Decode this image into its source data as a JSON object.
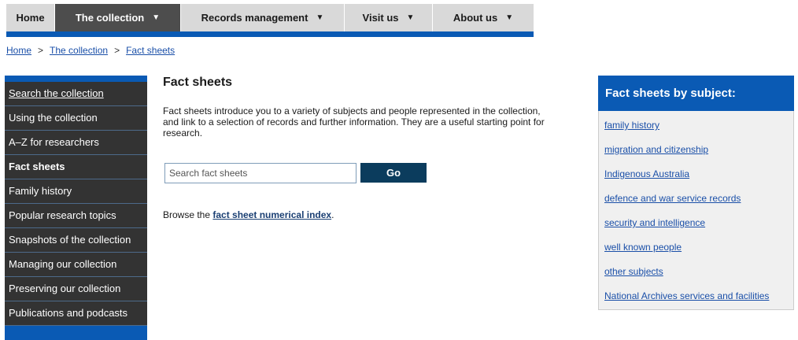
{
  "topnav": {
    "tabs": [
      {
        "label": "Home",
        "dropdown": false,
        "active": false
      },
      {
        "label": "The collection",
        "dropdown": true,
        "active": true
      },
      {
        "label": "Records management",
        "dropdown": true,
        "active": false
      },
      {
        "label": "Visit us",
        "dropdown": true,
        "active": false
      },
      {
        "label": "About us",
        "dropdown": true,
        "active": false
      }
    ],
    "caret": "▼"
  },
  "breadcrumb": {
    "items": [
      "Home",
      "The collection",
      "Fact sheets"
    ],
    "separator": ">"
  },
  "sidebar": {
    "items": [
      {
        "label": "Search the collection"
      },
      {
        "label": "Using the collection"
      },
      {
        "label": "A–Z for researchers"
      },
      {
        "label": "Fact sheets"
      },
      {
        "label": "Family history"
      },
      {
        "label": "Popular research topics"
      },
      {
        "label": "Snapshots of the collection"
      },
      {
        "label": "Managing our collection"
      },
      {
        "label": "Preserving our collection"
      },
      {
        "label": "Publications and podcasts"
      }
    ]
  },
  "main": {
    "title": "Fact sheets",
    "intro": "Fact sheets introduce you to a variety of subjects and people represented in the collection, and link to a selection of records and further information. They are a useful starting point for research.",
    "search": {
      "placeholder": "Search fact sheets",
      "value": "",
      "button_label": "Go"
    },
    "browse": {
      "prefix": "Browse the ",
      "link": "fact sheet numerical index",
      "suffix": "."
    }
  },
  "subject_panel": {
    "title": "Fact sheets by subject:",
    "links": [
      "family history",
      "migration and citizenship",
      "Indigenous Australia",
      "defence and war service records",
      "security and intelligence",
      "well known people",
      "other subjects",
      "National Archives services and facilities"
    ]
  },
  "colors": {
    "accent_blue": "#0a5ab4",
    "dark_nav": "#333333",
    "go_button": "#0b3c5d",
    "link": "#1a4fa8"
  }
}
